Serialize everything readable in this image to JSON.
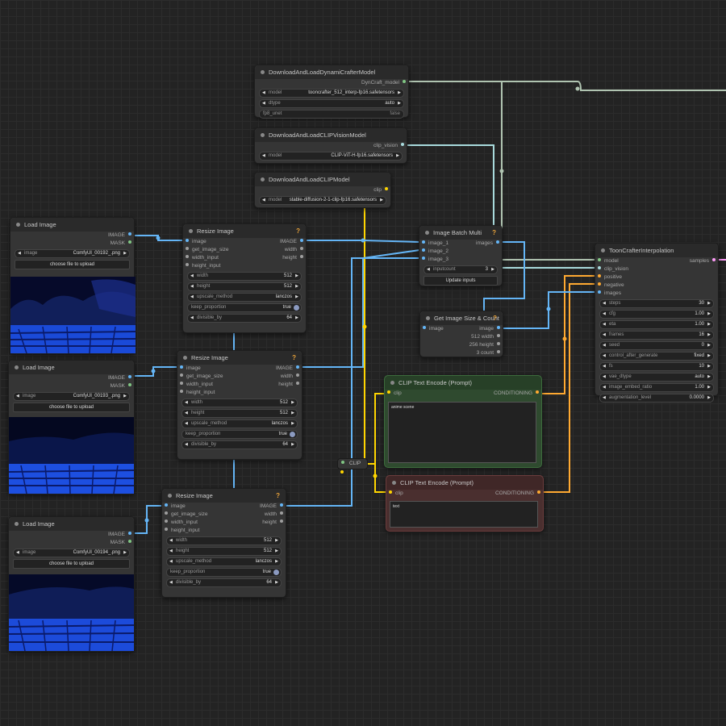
{
  "nodes": {
    "dc_model": {
      "title": "DownloadAndLoadDynamiCrafterModel",
      "output": "DynCraft_model",
      "model_label": "model",
      "model_value": "tooncrafter_512_interp-fp16.safetensors",
      "dtype_label": "dtype",
      "dtype_value": "auto",
      "fp8_label": "fp8_unet",
      "fp8_value": "false"
    },
    "clip_vision": {
      "title": "DownloadAndLoadCLIPVisionModel",
      "output": "clip_vision",
      "model_label": "model",
      "model_value": "CLIP-ViT-H-fp16.safetensors"
    },
    "clip_loader": {
      "title": "DownloadAndLoadCLIPModel",
      "output": "clip",
      "model_label": "model",
      "model_value": "stable-diffusion-2-1-clip-fp16.safetensors"
    },
    "load1": {
      "title": "Load Image",
      "out_image": "IMAGE",
      "out_mask": "MASK",
      "image_label": "image",
      "image_value": "ComfyUI_00192_.png",
      "upload": "choose file to upload"
    },
    "load2": {
      "title": "Load Image",
      "out_image": "IMAGE",
      "out_mask": "MASK",
      "image_label": "image",
      "image_value": "ComfyUI_00193_.png",
      "upload": "choose file to upload"
    },
    "load3": {
      "title": "Load Image",
      "out_image": "IMAGE",
      "out_mask": "MASK",
      "image_label": "image",
      "image_value": "ComfyUI_00194_.png",
      "upload": "choose file to upload"
    },
    "resize1": {
      "title": "Resize Image",
      "help": "?",
      "in_image": "image",
      "in_get_size": "get_image_size",
      "in_width": "width_input",
      "in_height": "height_input",
      "out_image": "IMAGE",
      "out_width": "width",
      "out_height": "height",
      "width_label": "width",
      "width_value": "512",
      "height_label": "height",
      "height_value": "512",
      "method_label": "upscale_method",
      "method_value": "lanczos",
      "keep_label": "keep_proportion",
      "keep_value": "true",
      "div_label": "divisible_by",
      "div_value": "64"
    },
    "resize2": {
      "title": "Resize Image",
      "help": "?",
      "in_image": "image",
      "in_get_size": "get_image_size",
      "in_width": "width_input",
      "in_height": "height_input",
      "out_image": "IMAGE",
      "out_width": "width",
      "out_height": "height",
      "width_label": "width",
      "width_value": "512",
      "height_label": "height",
      "height_value": "512",
      "method_label": "upscale_method",
      "method_value": "lanczos",
      "keep_label": "keep_proportion",
      "keep_value": "true",
      "div_label": "divisible_by",
      "div_value": "64"
    },
    "resize3": {
      "title": "Resize Image",
      "help": "?",
      "in_image": "image",
      "in_get_size": "get_image_size",
      "in_width": "width_input",
      "in_height": "height_input",
      "out_image": "IMAGE",
      "out_width": "width",
      "out_height": "height",
      "width_label": "width",
      "width_value": "512",
      "height_label": "height",
      "height_value": "512",
      "method_label": "upscale_method",
      "method_value": "lanczos",
      "keep_label": "keep_proportion",
      "keep_value": "true",
      "div_label": "divisible_by",
      "div_value": "64"
    },
    "batch": {
      "title": "Image Batch Multi",
      "help": "?",
      "in1": "image_1",
      "in2": "image_2",
      "in3": "image_3",
      "out": "images",
      "count_label": "inputcount",
      "count_value": "3",
      "update": "Update inputs"
    },
    "size_count": {
      "title": "Get Image Size & Count",
      "help": "?",
      "in_image": "image",
      "out_image": "image",
      "out_width": "512 width",
      "out_height": "256 height",
      "out_count": "3 count"
    },
    "tooncrafter": {
      "title": "ToonCrafterInterpolation",
      "in_model": "model",
      "in_vision": "clip_vision",
      "in_pos": "positive",
      "in_neg": "negative",
      "in_images": "images",
      "out": "samples",
      "widgets": [
        {
          "label": "steps",
          "value": "30"
        },
        {
          "label": "cfg",
          "value": "1.00"
        },
        {
          "label": "eta",
          "value": "1.00"
        },
        {
          "label": "frames",
          "value": "16"
        },
        {
          "label": "seed",
          "value": "0"
        },
        {
          "label": "control_after_generate",
          "value": "fixed"
        },
        {
          "label": "fs",
          "value": "10"
        },
        {
          "label": "vae_dtype",
          "value": "auto"
        },
        {
          "label": "image_embed_ratio",
          "value": "1.00"
        },
        {
          "label": "augmentation_level",
          "value": "0.0000"
        }
      ]
    },
    "clip_pos": {
      "title": "CLIP Text Encode (Prompt)",
      "in": "clip",
      "out": "CONDITIONING",
      "text": "anime scene"
    },
    "clip_neg": {
      "title": "CLIP Text Encode (Prompt)",
      "in": "clip",
      "out": "CONDITIONING",
      "text": "text"
    },
    "reroute": {
      "label": "CLIP"
    }
  },
  "colors": {
    "image_wire": "#64b5f6",
    "clip_wire": "#ffd500",
    "cond_wire": "#ffa931",
    "model_wire": "#b0c4b1",
    "vision_wire": "#a8dadc",
    "latent_wire": "#ff9cf9",
    "pos_node_bg": "#2f4a2f",
    "neg_node_bg": "#4a2f2f"
  },
  "icons": [
    "title-dot",
    "help-icon",
    "arrow-left-icon",
    "arrow-right-icon",
    "toggle-icon"
  ]
}
